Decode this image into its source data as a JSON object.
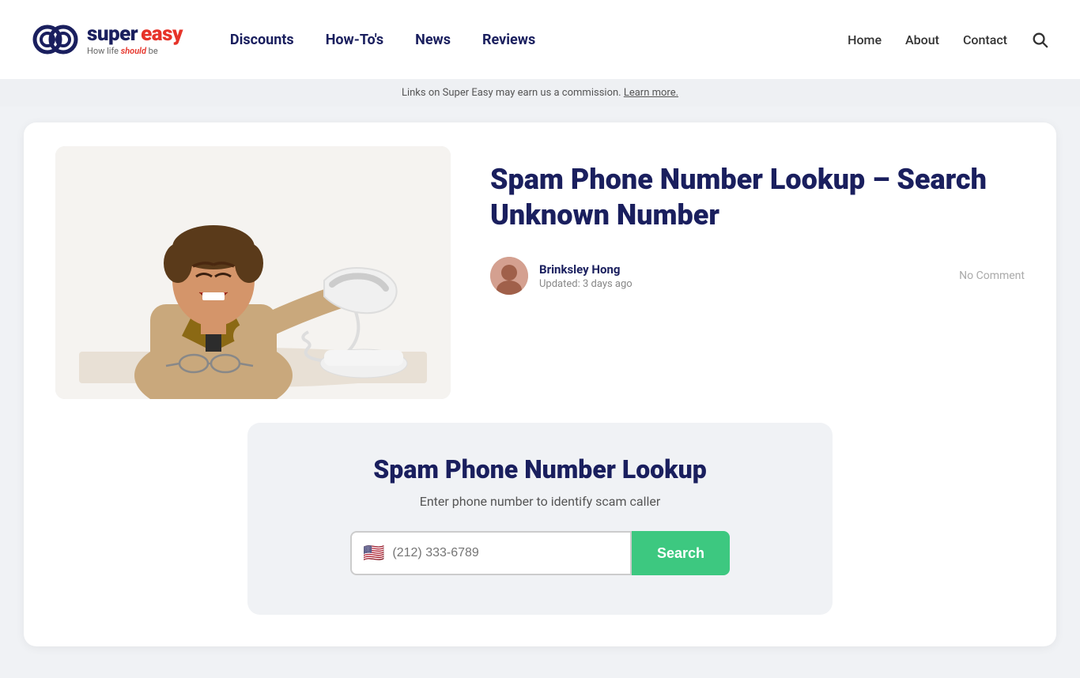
{
  "header": {
    "logo": {
      "super": "super",
      "easy": "easy",
      "tagline_prefix": "How life ",
      "tagline_em": "should",
      "tagline_suffix": " be"
    },
    "nav": {
      "items": [
        {
          "label": "Discounts",
          "href": "#"
        },
        {
          "label": "How-To's",
          "href": "#"
        },
        {
          "label": "News",
          "href": "#"
        },
        {
          "label": "Reviews",
          "href": "#"
        }
      ]
    },
    "right_nav": {
      "items": [
        {
          "label": "Home",
          "href": "#"
        },
        {
          "label": "About",
          "href": "#"
        },
        {
          "label": "Contact",
          "href": "#"
        }
      ]
    }
  },
  "commission_bar": {
    "text": "Links on Super Easy may earn us a commission.",
    "learn_more": "Learn more."
  },
  "article": {
    "title": "Spam Phone Number Lookup – Search Unknown Number",
    "author_name": "Brinksley Hong",
    "updated": "Updated: 3 days ago",
    "no_comment": "No Comment"
  },
  "lookup_widget": {
    "title": "Spam Phone Number Lookup",
    "subtitle": "Enter phone number to identify scam caller",
    "input_placeholder": "(212) 333-6789",
    "search_label": "Search"
  }
}
